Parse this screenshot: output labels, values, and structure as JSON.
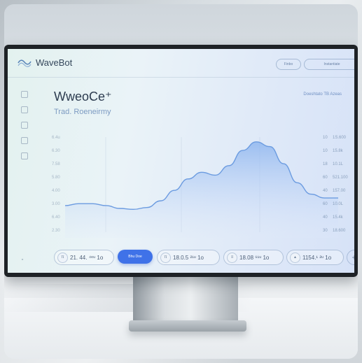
{
  "app": {
    "brand": "WaveBot",
    "header_pills": [
      "Finbo",
      "Instantiate"
    ]
  },
  "main": {
    "title": "WweoCe⁺",
    "subtitle": "Trad. Roeneirmy",
    "top_right": "Doeshtato  TB Azeas"
  },
  "sidebar": {
    "icons": [
      "grid-icon",
      "document-icon",
      "bookmark-icon",
      "calendar-icon",
      "stack-icon"
    ],
    "corner_glyph": "„"
  },
  "chart_data": {
    "type": "area",
    "y_tick_labels": [
      "6.4u",
      "6.30",
      "7.58",
      "5.80",
      "4.00",
      "3.00",
      "6.40",
      "2.30"
    ],
    "right_labels": [
      {
        "a": "10",
        "b": "1S.600"
      },
      {
        "a": "10",
        "b": "15.8k"
      },
      {
        "a": "18",
        "b": "10.1L"
      },
      {
        "a": "60",
        "b": "521.100"
      },
      {
        "a": "40",
        "b": "157.00"
      },
      {
        "a": "60",
        "b": "10.0L"
      },
      {
        "a": "40",
        "b": "15.4k"
      },
      {
        "a": "30",
        "b": "18.600"
      }
    ],
    "grid": true,
    "curve_y": [
      0.28,
      0.3,
      0.3,
      0.28,
      0.25,
      0.24,
      0.26,
      0.33,
      0.44,
      0.56,
      0.63,
      0.6,
      0.7,
      0.86,
      0.95,
      0.9,
      0.72,
      0.52,
      0.4,
      0.36,
      0.36
    ],
    "colors": {
      "line": "#6b9be0",
      "fill_top": "#8fb6ef",
      "fill_bottom": "#dfe9fb"
    }
  },
  "toolbar": {
    "chips": [
      {
        "icon": "π",
        "text": "21. 44.  ⁴ᵉᵘ  1o"
      },
      {
        "icon": "π",
        "text": "18.0.5  ²¹ᵘ  1o"
      },
      {
        "icon": "≡",
        "text": "18.08  ⁶¹ᵘ  1o"
      },
      {
        "icon": "▴",
        "text": "1154.¹  ²ᵘ  1o"
      }
    ],
    "primary_label": "Bhu Doe",
    "plus": "+"
  }
}
